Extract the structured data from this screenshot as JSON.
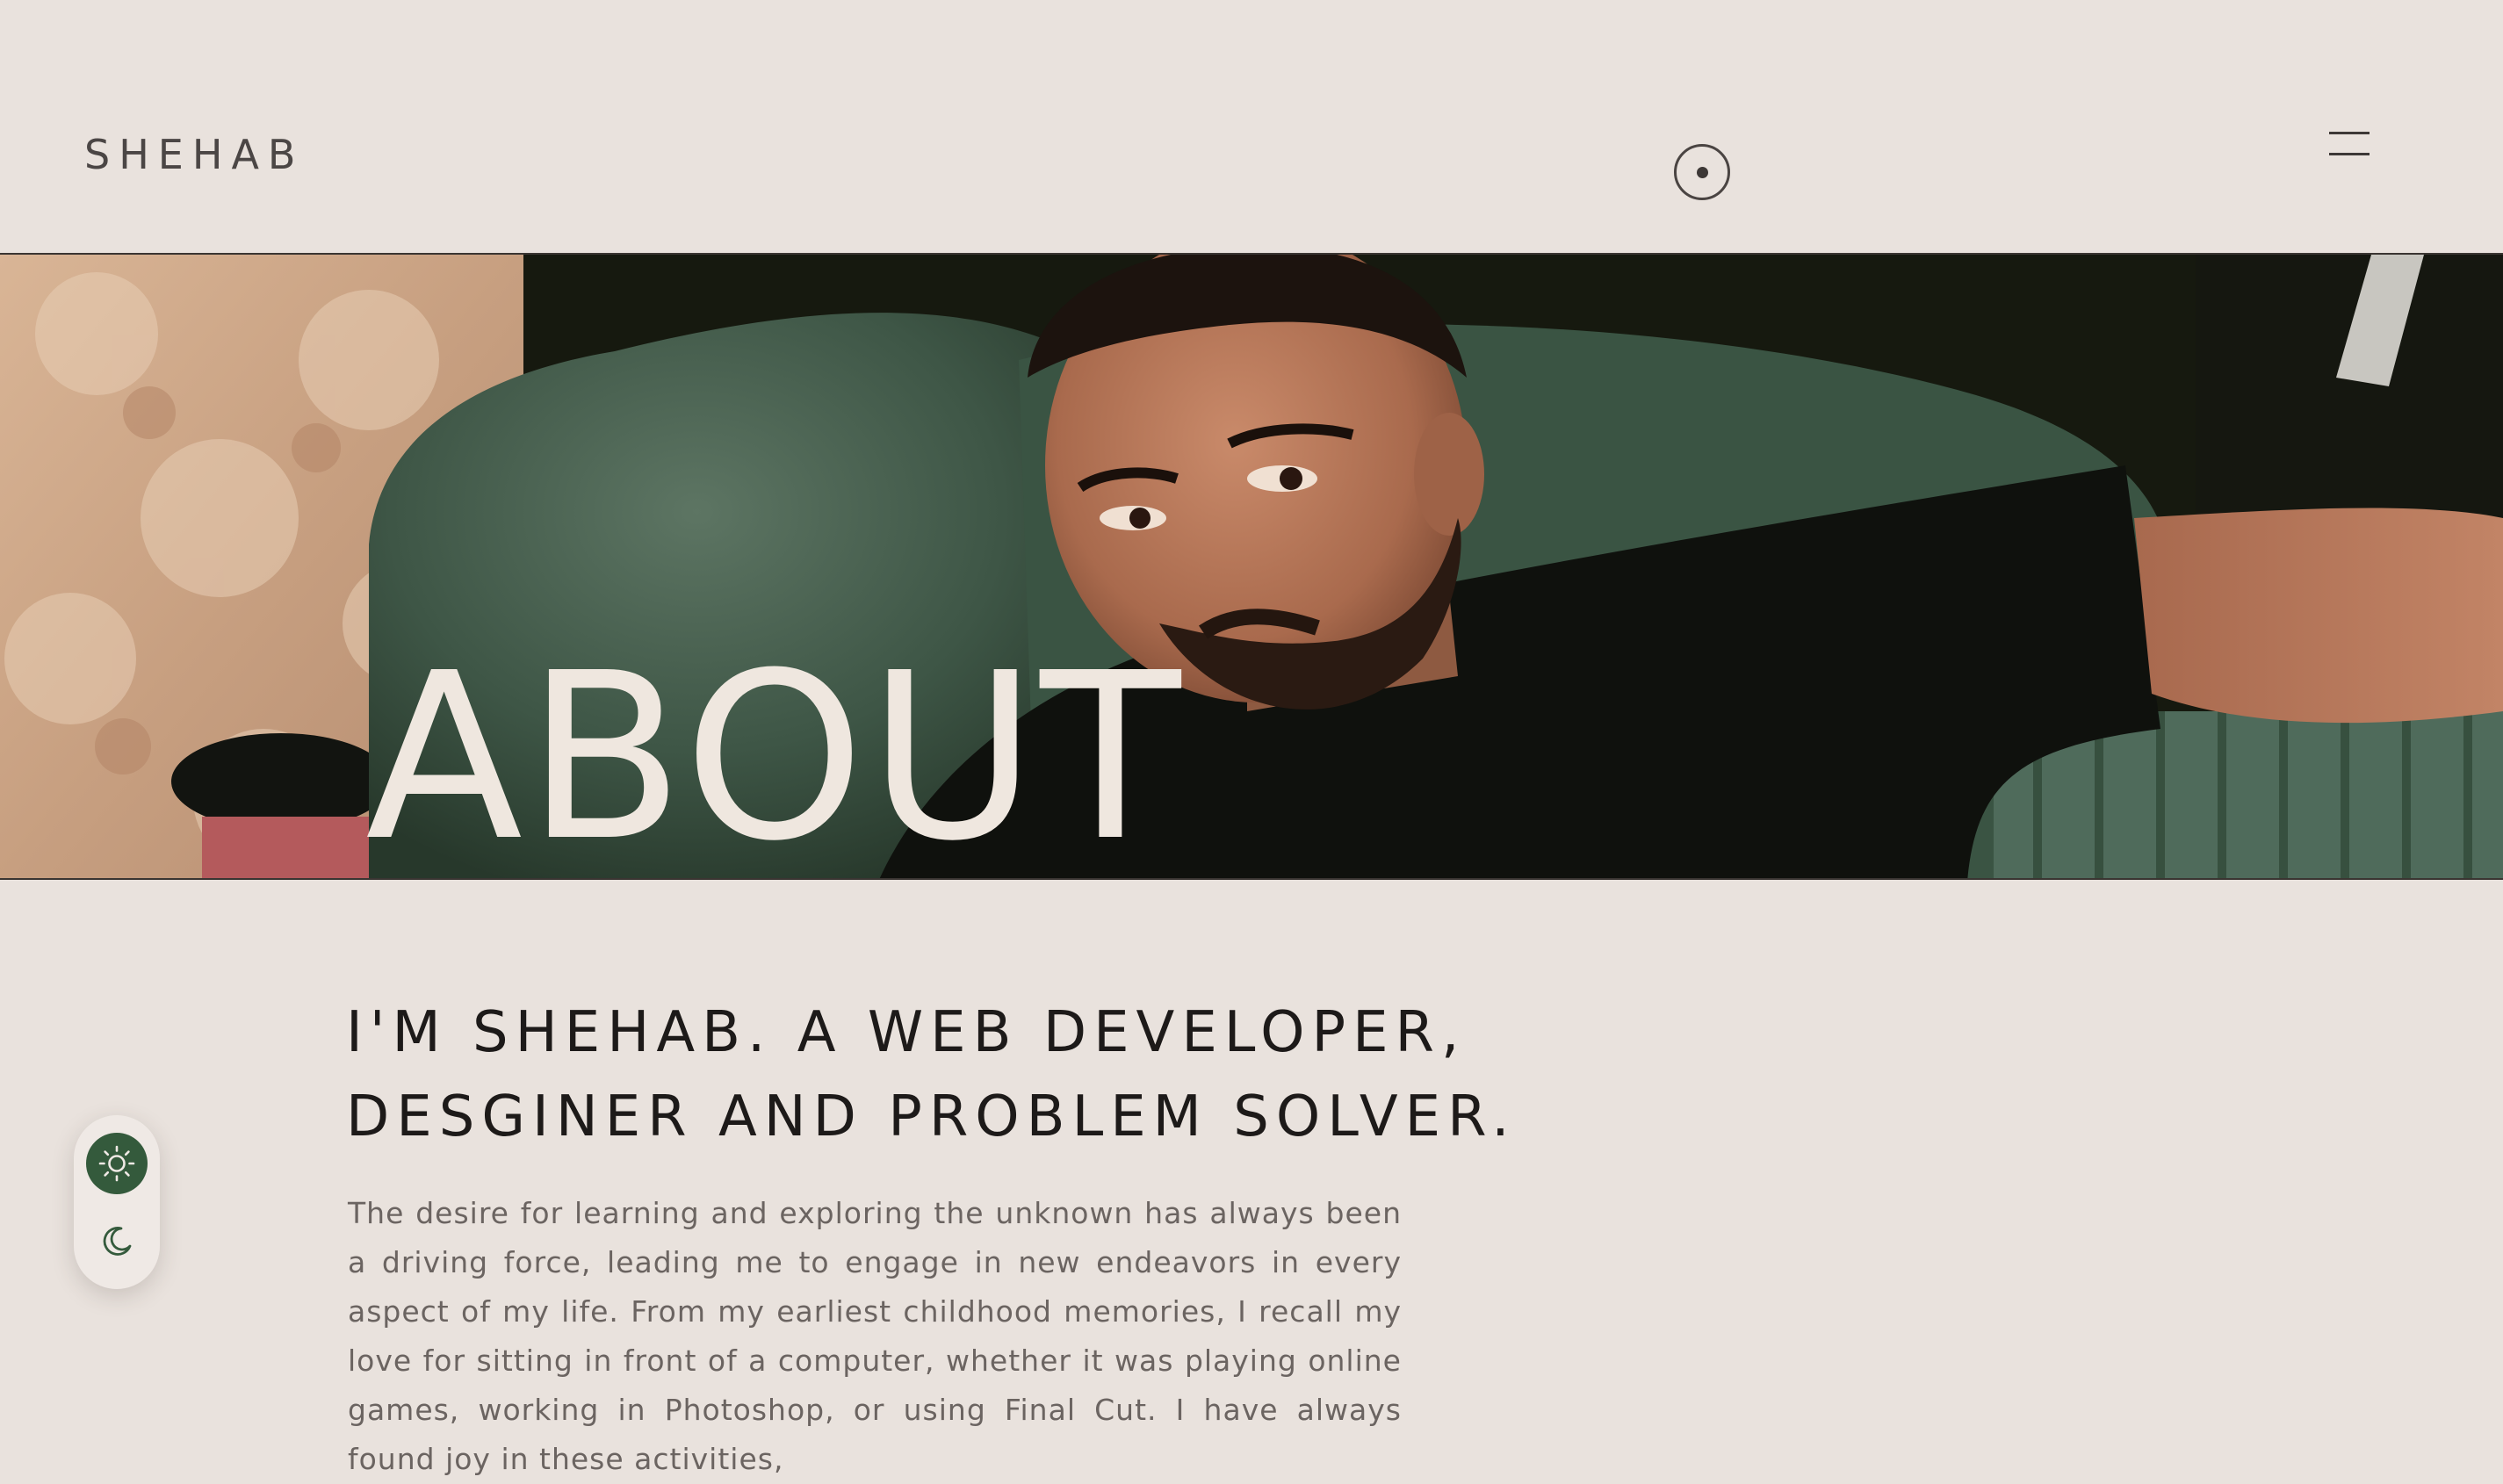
{
  "header": {
    "logo": "SHEHAB",
    "menu_icon": "hamburger-menu-icon",
    "cursor_icon": "cursor-dot-icon"
  },
  "hero": {
    "title": "ABOUT",
    "image_alt": "Portrait photo of man in black shirt on green velvet armchair"
  },
  "about": {
    "heading": "I'M SHEHAB. A WEB DEVELOPER, DESGINER AND PROBLEM SOLVER.",
    "body": "The desire for learning and exploring the unknown has always been a driving force, leading me to engage in new endeavors in every aspect of my life. From my earliest childhood memories, I recall my love for sitting in front of a computer, whether it was playing online games, working in Photoshop, or using Final Cut. I have always found joy in these activities,"
  },
  "theme_toggle": {
    "light_icon": "sun-icon",
    "dark_icon": "moon-icon",
    "active": "light"
  },
  "colors": {
    "background": "#e9e2dd",
    "accent": "#345a3c",
    "text": "#1d1a19",
    "muted_text": "#6b6461",
    "hero_title": "#efe7df"
  }
}
